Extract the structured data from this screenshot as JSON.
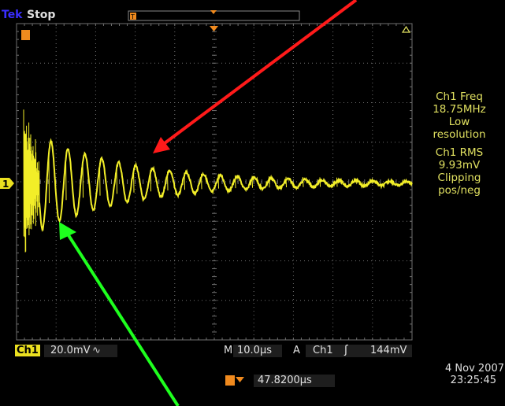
{
  "header": {
    "brand": "Tek",
    "run_state": "Stop"
  },
  "channel_marker": "1",
  "trigger_marker": "T",
  "measurements": {
    "freq_label": "Ch1 Freq",
    "freq_value": "18.75MHz",
    "freq_note_1": "Low",
    "freq_note_2": "resolution",
    "rms_label": "Ch1 RMS",
    "rms_value": "9.93mV",
    "rms_note_1": "Clipping",
    "rms_note_2": "pos/neg"
  },
  "bottom": {
    "channel": "Ch1",
    "volts_per_div": "20.0mV",
    "coupling_symbol": "∿",
    "timebase_prefix": "M",
    "timebase": "10.0µs",
    "trigger_prefix": "A",
    "trigger_source": "Ch1",
    "trigger_slope": "ʃ",
    "trigger_level": "144mV",
    "trigger_position": "47.8200µs",
    "date": "4 Nov 2007",
    "time": "23:25:45"
  },
  "colors": {
    "trace": "#f2ee28",
    "grid": "#707070",
    "marker": "#f08a1e",
    "arrow_red": "#ff1a1a",
    "arrow_green": "#1eff1e"
  }
}
